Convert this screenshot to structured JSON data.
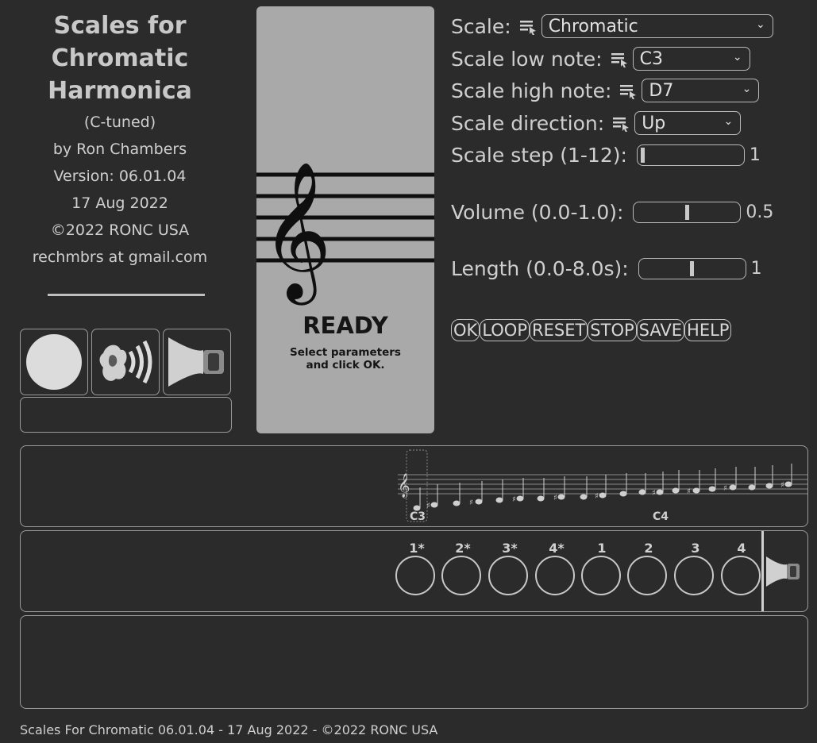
{
  "info": {
    "title_lines": [
      "Scales for",
      "Chromatic",
      "Harmonica"
    ],
    "tuning": "(C-tuned)",
    "author": "by Ron Chambers",
    "version": "Version: 06.01.04",
    "date": "17 Aug 2022",
    "copyright": "©2022 RONC USA",
    "contact": "rechmbrs at gmail.com"
  },
  "status": {
    "title": "READY",
    "message": "Select parameters\nand click OK."
  },
  "controls": {
    "scale": {
      "label": "Scale:",
      "value": "Chromatic"
    },
    "low_note": {
      "label": "Scale low note:",
      "value": "C3"
    },
    "high_note": {
      "label": "Scale high note:",
      "value": "D7"
    },
    "direction": {
      "label": "Scale direction:",
      "value": "Up"
    },
    "step": {
      "label": "Scale step (1-12):",
      "value": "1",
      "fraction": 0.0
    },
    "volume": {
      "label": "Volume (0.0-1.0):",
      "value": "0.5",
      "fraction": 0.5
    },
    "length": {
      "label": "Length (0.0-8.0s):",
      "value": "1",
      "fraction": 0.5
    }
  },
  "buttons": [
    "OK",
    "LOOP",
    "RESET",
    "STOP",
    "SAVE",
    "HELP"
  ],
  "staff": {
    "labels": [
      "C3",
      "C4"
    ]
  },
  "holes": {
    "labels": [
      "1*",
      "2*",
      "3*",
      "4*",
      "1",
      "2",
      "3",
      "4"
    ]
  },
  "footer": "Scales For Chromatic 06.01.04 - 17 Aug 2022 - ©2022 RONC USA"
}
